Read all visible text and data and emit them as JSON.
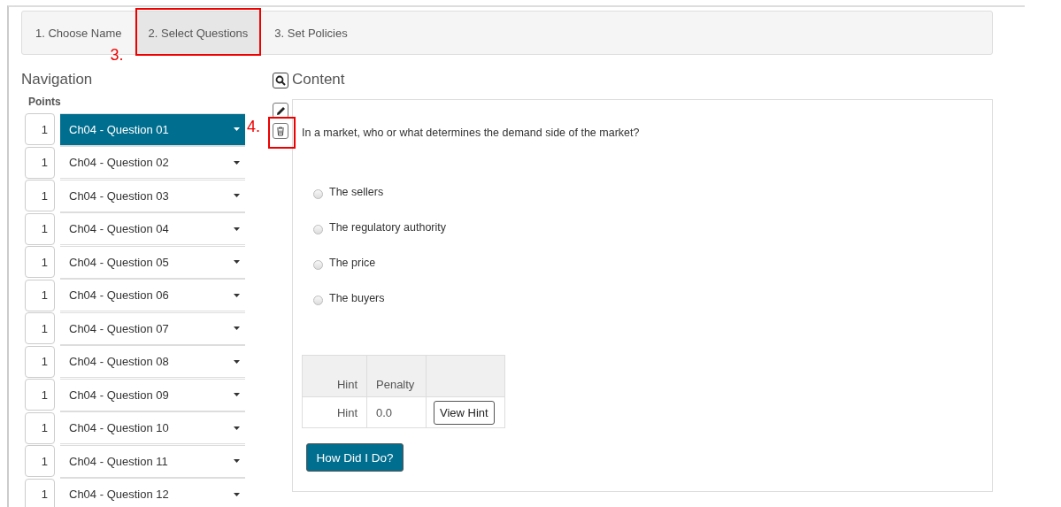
{
  "tabs": [
    {
      "label": "1. Choose Name",
      "selected": false
    },
    {
      "label": "2. Select Questions",
      "selected": true,
      "annotation": "3."
    },
    {
      "label": "3. Set Policies",
      "selected": false
    }
  ],
  "navigation": {
    "title": "Navigation",
    "points_label": "Points",
    "items": [
      {
        "points": "1",
        "label": "Ch04 - Question 01",
        "selected": true
      },
      {
        "points": "1",
        "label": "Ch04 - Question 02",
        "selected": false
      },
      {
        "points": "1",
        "label": "Ch04 - Question 03",
        "selected": false
      },
      {
        "points": "1",
        "label": "Ch04 - Question 04",
        "selected": false
      },
      {
        "points": "1",
        "label": "Ch04 - Question 05",
        "selected": false
      },
      {
        "points": "1",
        "label": "Ch04 - Question 06",
        "selected": false
      },
      {
        "points": "1",
        "label": "Ch04 - Question 07",
        "selected": false
      },
      {
        "points": "1",
        "label": "Ch04 - Question 08",
        "selected": false
      },
      {
        "points": "1",
        "label": "Ch04 - Question 09",
        "selected": false
      },
      {
        "points": "1",
        "label": "Ch04 - Question 10",
        "selected": false
      },
      {
        "points": "1",
        "label": "Ch04 - Question 11",
        "selected": false
      },
      {
        "points": "1",
        "label": "Ch04 - Question 12",
        "selected": false
      }
    ]
  },
  "content": {
    "title": "Content",
    "delete_annotation": "4.",
    "question": "In a market, who or what determines the demand side of the market?",
    "options": [
      {
        "label": "The sellers",
        "selected": false
      },
      {
        "label": "The regulatory authority",
        "selected": false
      },
      {
        "label": "The price",
        "selected": false
      },
      {
        "label": "The buyers",
        "selected": false
      }
    ],
    "hint_table": {
      "columns": [
        "Hint",
        "Penalty"
      ],
      "rows": [
        {
          "hint": "Hint",
          "penalty": "0.0",
          "action": "View Hint"
        }
      ]
    },
    "submit": "How Did I Do?"
  }
}
